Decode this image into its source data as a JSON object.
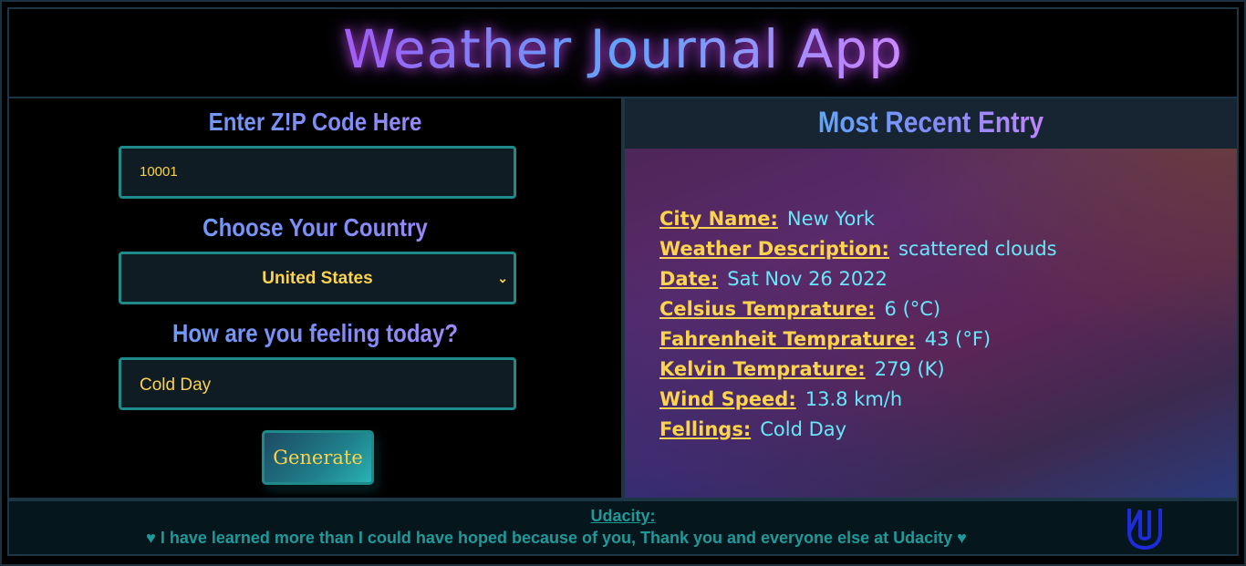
{
  "header": {
    "title": "Weather Journal App"
  },
  "form": {
    "zip_label": "Enter Z!P Code Here",
    "zip_value": "10001",
    "country_label": "Choose Your Country",
    "country_selected": "United States",
    "feeling_label": "How are you feeling today?",
    "feeling_value": "Cold Day",
    "generate_label": "Generate"
  },
  "recent": {
    "title": "Most Recent Entry",
    "entries": [
      {
        "key": "City Name:",
        "value": "New York"
      },
      {
        "key": "Weather Description:",
        "value": "scattered clouds"
      },
      {
        "key": "Date:",
        "value": "Sat Nov 26 2022"
      },
      {
        "key": "Celsius Temprature:",
        "value": "6 (°C)"
      },
      {
        "key": "Fahrenheit Temprature:",
        "value": "43 (°F)"
      },
      {
        "key": "Kelvin Temprature:",
        "value": "279 (K)"
      },
      {
        "key": "Wind Speed:",
        "value": "13.8 km/h"
      },
      {
        "key": "Fellings:",
        "value": "Cold Day"
      }
    ]
  },
  "footer": {
    "title": "Udacity:",
    "message": "♥ I have learned more than I could have hoped because of you, Thank you and everyone else at Udacity ♥",
    "logo_icon": "udacity-logo-icon"
  },
  "colors": {
    "accent_yellow": "#fcd34d",
    "accent_cyan": "#67e8f9",
    "teal_border": "#1f8a8a"
  }
}
